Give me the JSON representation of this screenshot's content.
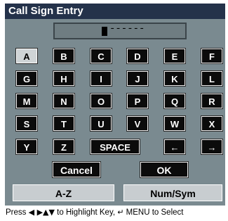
{
  "window": {
    "title": "Call Sign Entry"
  },
  "entry": {
    "value": "------"
  },
  "keys": [
    {
      "label": "A",
      "name": "key-a",
      "selected": true
    },
    {
      "label": "B",
      "name": "key-b"
    },
    {
      "label": "C",
      "name": "key-c"
    },
    {
      "label": "D",
      "name": "key-d"
    },
    {
      "label": "E",
      "name": "key-e"
    },
    {
      "label": "F",
      "name": "key-f"
    },
    {
      "label": "G",
      "name": "key-g"
    },
    {
      "label": "H",
      "name": "key-h"
    },
    {
      "label": "I",
      "name": "key-i"
    },
    {
      "label": "J",
      "name": "key-j"
    },
    {
      "label": "K",
      "name": "key-k"
    },
    {
      "label": "L",
      "name": "key-l"
    },
    {
      "label": "M",
      "name": "key-m"
    },
    {
      "label": "N",
      "name": "key-n"
    },
    {
      "label": "O",
      "name": "key-o"
    },
    {
      "label": "P",
      "name": "key-p"
    },
    {
      "label": "Q",
      "name": "key-q"
    },
    {
      "label": "R",
      "name": "key-r"
    },
    {
      "label": "S",
      "name": "key-s"
    },
    {
      "label": "T",
      "name": "key-t"
    },
    {
      "label": "U",
      "name": "key-u"
    },
    {
      "label": "V",
      "name": "key-v"
    },
    {
      "label": "W",
      "name": "key-w"
    },
    {
      "label": "X",
      "name": "key-x"
    },
    {
      "label": "Y",
      "name": "key-y"
    },
    {
      "label": "Z",
      "name": "key-z"
    },
    {
      "label": "SPACE",
      "name": "key-space"
    },
    {
      "label": "←",
      "name": "left-arrow-key",
      "icon": "left-arrow-icon"
    },
    {
      "label": "→",
      "name": "right-arrow-key",
      "icon": "right-arrow-icon"
    }
  ],
  "actions": {
    "cancel_label": "Cancel",
    "ok_label": "OK"
  },
  "tabs": {
    "az_label": "A-Z",
    "numsym_label": "Num/Sym"
  },
  "help": {
    "prefix": "Press",
    "arrows": "◀ ▶▲▼",
    "middle": "to Highlight Key,",
    "enter_glyph": "↵",
    "suffix": "MENU to Select"
  },
  "colors": {
    "title_bar": "#24324a",
    "panel": "#7a8a90",
    "key": "#0b0b0b",
    "key_selected": "#cfd4d6",
    "tab": "#c8cdd0"
  }
}
